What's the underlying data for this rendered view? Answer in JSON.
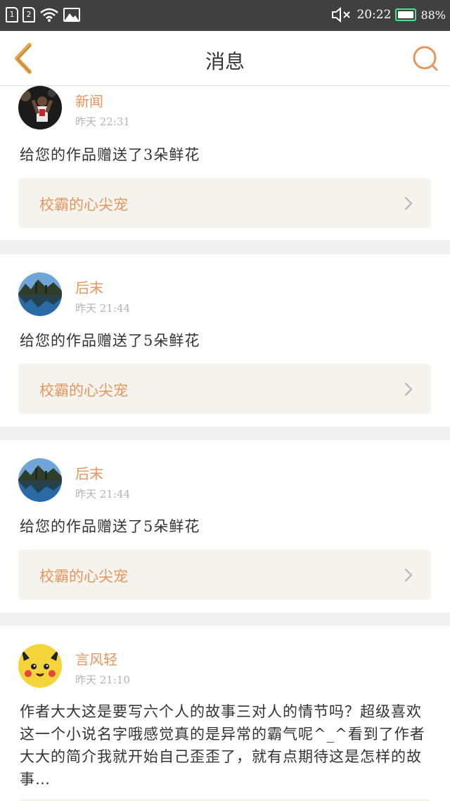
{
  "status_bar": {
    "sim1": "1",
    "sim2": "2",
    "time": "20:22",
    "battery": "88%",
    "battery_color": "#4de08e"
  },
  "nav": {
    "title": "消息",
    "back_icon": "chevron-left-icon",
    "search_icon": "search-icon",
    "accent": "#e8955d"
  },
  "messages": [
    {
      "user": "新闻",
      "time": "昨天 22:31",
      "text": "给您的作品赠送了3朵鲜花",
      "work_title": "校霸的心尖宠",
      "avatar": "basketball-player-avatar"
    },
    {
      "user": "后末",
      "time": "昨天 21:44",
      "text": "给您的作品赠送了5朵鲜花",
      "work_title": "校霸的心尖宠",
      "avatar": "lake-landscape-avatar"
    },
    {
      "user": "后末",
      "time": "昨天 21:44",
      "text": "给您的作品赠送了5朵鲜花",
      "work_title": "校霸的心尖宠",
      "avatar": "lake-landscape-avatar"
    },
    {
      "user": "言风轻",
      "time": "昨天 21:10",
      "text": "作者大大这是要写六个人的故事三对人的情节吗？超级喜欢这一个小说名字哦感觉真的是异常的霸气呢^_^看到了作者大大的简介我就开始自己歪歪了，就有点期待这是怎样的故事…",
      "avatar": "pikachu-avatar"
    }
  ]
}
